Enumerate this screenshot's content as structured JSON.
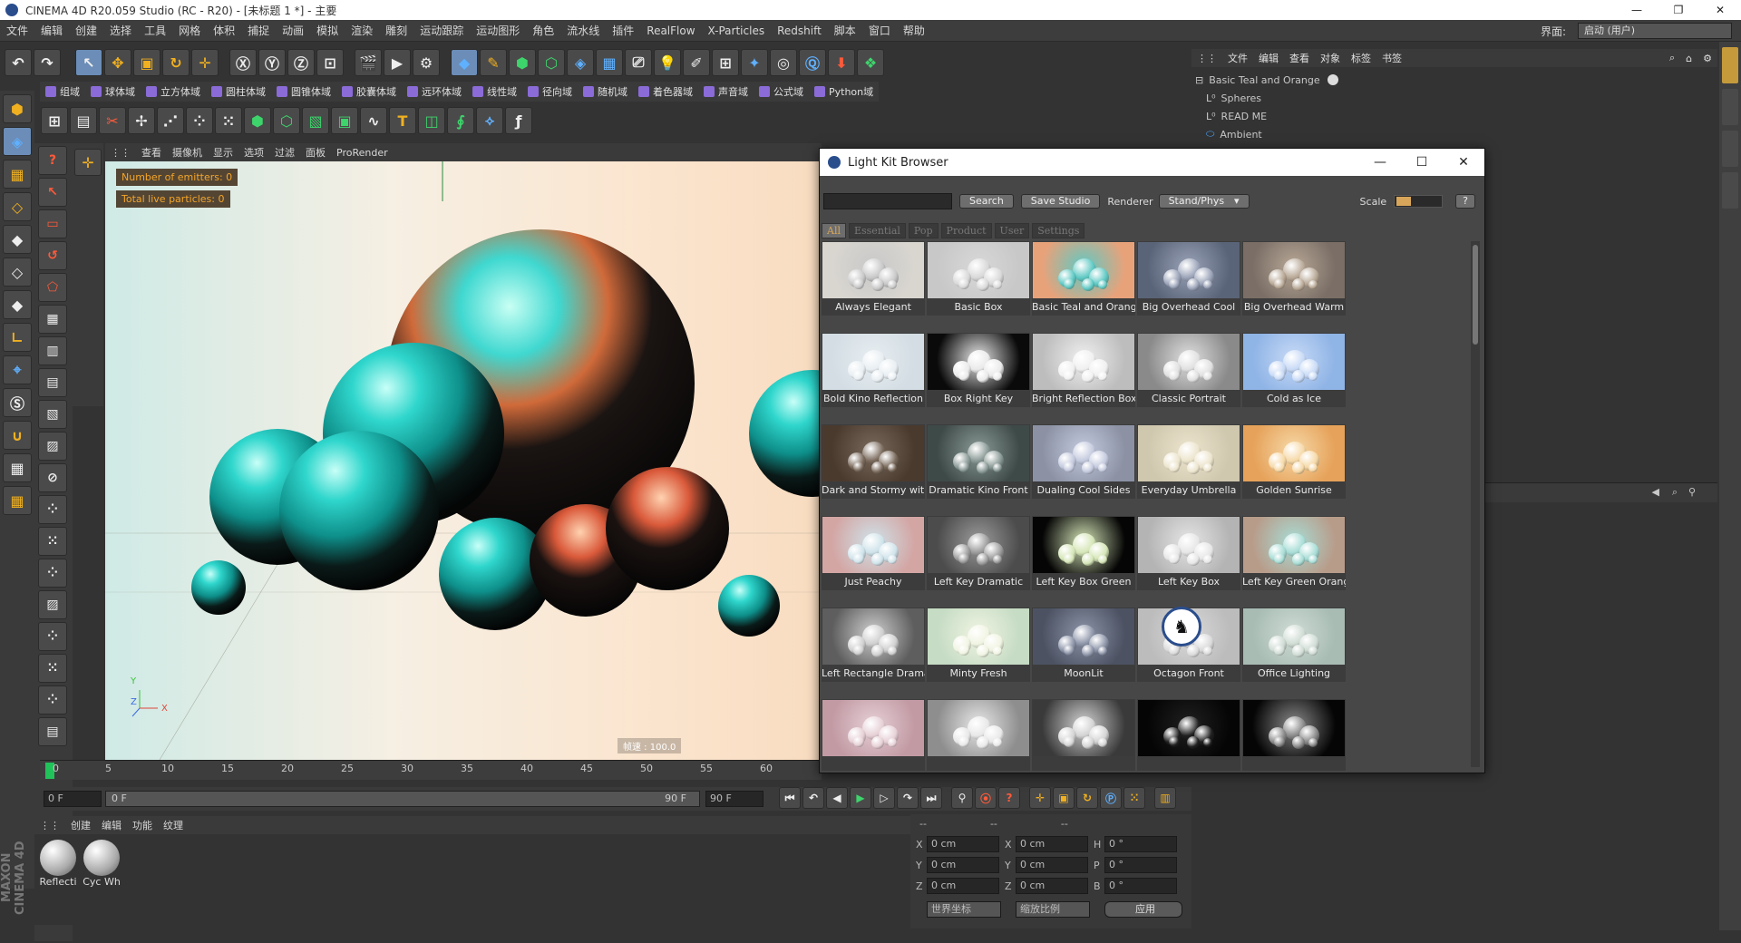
{
  "window": {
    "title": "CINEMA 4D R20.059 Studio (RC - R20) - [未标题 1 *] - 主要"
  },
  "menu": [
    "文件",
    "编辑",
    "创建",
    "选择",
    "工具",
    "网格",
    "体积",
    "捕捉",
    "动画",
    "模拟",
    "渲染",
    "雕刻",
    "运动跟踪",
    "运动图形",
    "角色",
    "流水线",
    "插件",
    "RealFlow",
    "X-Particles",
    "Redshift",
    "脚本",
    "窗口",
    "帮助"
  ],
  "layout": {
    "label": "界面:",
    "value": "启动 (用户)"
  },
  "row2": [
    "组域",
    "球体域",
    "立方体域",
    "圆柱体域",
    "圆锥体域",
    "胶囊体域",
    "远环体域",
    "线性域",
    "径向域",
    "随机域",
    "着色器域",
    "声音域",
    "公式域",
    "Python域"
  ],
  "viewport": {
    "menu": [
      "查看",
      "摄像机",
      "显示",
      "选项",
      "过滤",
      "面板",
      "ProRender"
    ],
    "hud": [
      "Number of emitters: 0",
      "Total live particles: 0"
    ],
    "badge": "帧速 : 100.0",
    "axis": {
      "y": "Y",
      "z": "Z",
      "x": "X"
    }
  },
  "timeline": {
    "ticks": [
      "0",
      "5",
      "10",
      "15",
      "20",
      "25",
      "30",
      "35",
      "40",
      "45",
      "50",
      "55",
      "60"
    ]
  },
  "transport": {
    "start": "0 F",
    "current": "0 F",
    "end_inner": "90 F",
    "end": "90 F"
  },
  "material_manager": {
    "menu": [
      "创建",
      "编辑",
      "功能",
      "纹理"
    ],
    "materials": [
      "Reflecti",
      "Cyc Wh"
    ]
  },
  "coords": {
    "headers": [
      "--",
      "--",
      "--"
    ],
    "rows": [
      {
        "a": "X",
        "av": "0 cm",
        "b": "X",
        "bv": "0 cm",
        "c": "H",
        "cv": "0 °"
      },
      {
        "a": "Y",
        "av": "0 cm",
        "b": "Y",
        "bv": "0 cm",
        "c": "P",
        "cv": "0 °"
      },
      {
        "a": "Z",
        "av": "0 cm",
        "b": "Z",
        "bv": "0 cm",
        "c": "B",
        "cv": "0 °"
      }
    ],
    "mode1": "世界坐标",
    "mode2": "缩放比例",
    "apply": "应用"
  },
  "object_manager": {
    "menu": [
      "文件",
      "编辑",
      "查看",
      "对象",
      "标签",
      "书签"
    ],
    "objects": [
      "Basic Teal and Orange",
      "Spheres",
      "READ ME",
      "Ambient"
    ]
  },
  "lightkit": {
    "title": "Light Kit Browser",
    "search": "Search",
    "save": "Save Studio",
    "renderer_label": "Renderer",
    "renderer": "Stand/Phys",
    "scale_label": "Scale",
    "help": "?",
    "tabs": [
      "All",
      "Essential",
      "Pop",
      "Product",
      "User",
      "Settings"
    ],
    "presets": [
      {
        "name": "Always Elegant",
        "bg": "#d9d6d0",
        "c": "#c8c8c8"
      },
      {
        "name": "Basic Box",
        "bg": "#c8c8c8",
        "c": "#d8d8d8"
      },
      {
        "name": "Basic Teal and Orange",
        "bg": "#e8a27a",
        "c": "#5fc9c4"
      },
      {
        "name": "Big Overhead Cool",
        "bg": "#5a6478",
        "c": "#9aa3b8"
      },
      {
        "name": "Big Overhead Warm",
        "bg": "#7a6e66",
        "c": "#b8a896"
      },
      {
        "name": "Bold Kino Reflection",
        "bg": "#d3dde3",
        "c": "#e8eef2"
      },
      {
        "name": "Box Right Key",
        "bg": "#0a0a0a",
        "c": "#eaeaea"
      },
      {
        "name": "Bright Reflection Box",
        "bg": "#bdbdbd",
        "c": "#f0f0f0"
      },
      {
        "name": "Classic Portrait",
        "bg": "#8a8a8a",
        "c": "#e0e0e0"
      },
      {
        "name": "Cold as Ice",
        "bg": "#8fb4e6",
        "c": "#c8daf6"
      },
      {
        "name": "Dark and Stormy with ...",
        "bg": "#4a3a2e",
        "c": "#7a6a5c"
      },
      {
        "name": "Dramatic Kino Front",
        "bg": "#3e4a48",
        "c": "#8a9a96"
      },
      {
        "name": "Dualing Cool Sides",
        "bg": "#8c92a4",
        "c": "#c4cade"
      },
      {
        "name": "Everyday Umbrella",
        "bg": "#cfc7ae",
        "c": "#ece4cc"
      },
      {
        "name": "Golden Sunrise",
        "bg": "#e6a25a",
        "c": "#f6d9a8"
      },
      {
        "name": "Just Peachy",
        "bg": "#d3a6a4",
        "c": "#cfe3ea"
      },
      {
        "name": "Left  Key Dramatic",
        "bg": "#4c4c4c",
        "c": "#9c9c9c"
      },
      {
        "name": "Left Key Box Green",
        "bg": "#050505",
        "c": "#d6e6b8"
      },
      {
        "name": "Left Key Box",
        "bg": "#b4b4b4",
        "c": "#e6e6e6"
      },
      {
        "name": "Left Key Green Orange",
        "bg": "#b89c8a",
        "c": "#a8ddd6"
      },
      {
        "name": "Left Rectangle Dramatic",
        "bg": "#5e5e5e",
        "c": "#cfcfcf"
      },
      {
        "name": "Minty Fresh",
        "bg": "#c6dcc4",
        "c": "#f0f4e2"
      },
      {
        "name": "MoonLit",
        "bg": "#4c5262",
        "c": "#8c94a8"
      },
      {
        "name": "Octagon Front",
        "bg": "#bcbcbc",
        "c": "#dadada"
      },
      {
        "name": "Office Lighting",
        "bg": "#a8bcb4",
        "c": "#cfdcd4"
      },
      {
        "name": "",
        "bg": "#c29aa4",
        "c": "#e6d0d6"
      },
      {
        "name": "",
        "bg": "#8e8e8e",
        "c": "#e8e8e8"
      },
      {
        "name": "",
        "bg": "#3a3a3a",
        "c": "#d4d4d4"
      },
      {
        "name": "",
        "bg": "#050505",
        "c": "#202020"
      },
      {
        "name": "",
        "bg": "#050505",
        "c": "#8a8a8a"
      }
    ]
  }
}
